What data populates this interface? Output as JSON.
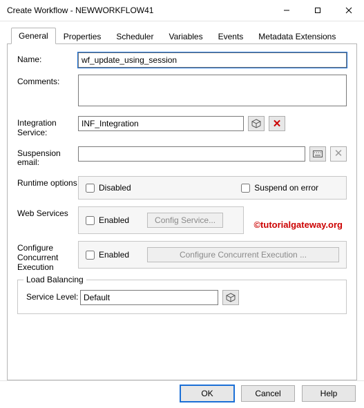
{
  "window": {
    "title": "Create Workflow - NEWWORKFLOW41"
  },
  "tabs": [
    {
      "label": "General"
    },
    {
      "label": "Properties"
    },
    {
      "label": "Scheduler"
    },
    {
      "label": "Variables"
    },
    {
      "label": "Events"
    },
    {
      "label": "Metadata Extensions"
    }
  ],
  "general": {
    "name_label": "Name:",
    "name_value": "wf_update_using_session",
    "comments_label": "Comments:",
    "comments_value": "",
    "integration_label": "Integration Service:",
    "integration_value": "INF_Integration",
    "suspension_label": "Suspension email:",
    "suspension_value": "",
    "runtime_label": "Runtime options",
    "runtime_disabled_label": "Disabled",
    "runtime_suspend_label": "Suspend on error",
    "webservices_label": "Web Services",
    "webservices_enabled_label": "Enabled",
    "webservices_config_btn": "Config Service...",
    "concurrent_label": "Configure Concurrent Execution",
    "concurrent_enabled_label": "Enabled",
    "concurrent_config_btn": "Configure Concurrent Execution ...",
    "load_balancing_legend": "Load Balancing",
    "service_level_label": "Service Level:",
    "service_level_value": "Default"
  },
  "footer": {
    "ok": "OK",
    "cancel": "Cancel",
    "help": "Help"
  },
  "watermark": "©tutorialgateway.org"
}
